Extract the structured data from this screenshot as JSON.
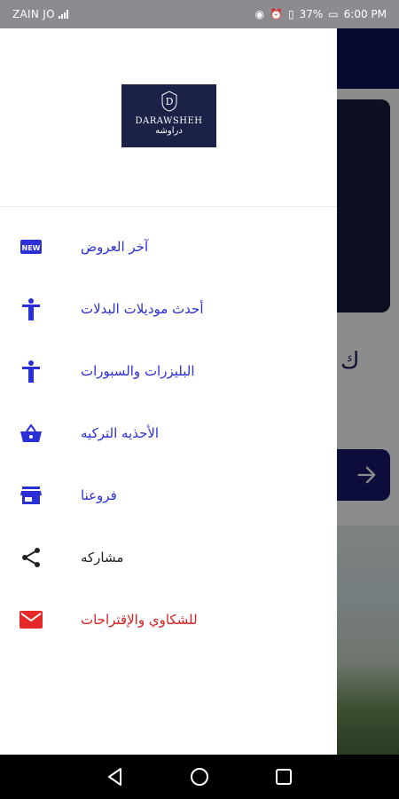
{
  "status_bar": {
    "carrier": "ZAIN JO",
    "battery": "37%",
    "time": "6:00 PM"
  },
  "logo": {
    "brand_en": "DARAWSHEH",
    "brand_ar": "دراوشه"
  },
  "menu": {
    "items": [
      {
        "label": "آخر العروض",
        "icon": "new-badge-icon",
        "color": "#2a2fd6"
      },
      {
        "label": "أحدث موديلات البدلات",
        "icon": "person-icon",
        "color": "#2a2fd6"
      },
      {
        "label": "البليزرات والسبورات",
        "icon": "person-icon",
        "color": "#2a2fd6"
      },
      {
        "label": "الأحذيه التركيه",
        "icon": "basket-icon",
        "color": "#2a2fd6"
      },
      {
        "label": "فروعنا",
        "icon": "store-icon",
        "color": "#2a2fd6"
      },
      {
        "label": "مشاركه",
        "icon": "share-icon",
        "color": "#222222"
      },
      {
        "label": "للشكاوي والإقتراحات",
        "icon": "mail-icon",
        "color": "#d42020"
      }
    ]
  },
  "background": {
    "partial_text": "ك"
  },
  "colors": {
    "drawer_accent": "#2a2fd6",
    "app_bar": "#11135a",
    "logo_bg": "#1b2147",
    "mail_red": "#e52828"
  }
}
